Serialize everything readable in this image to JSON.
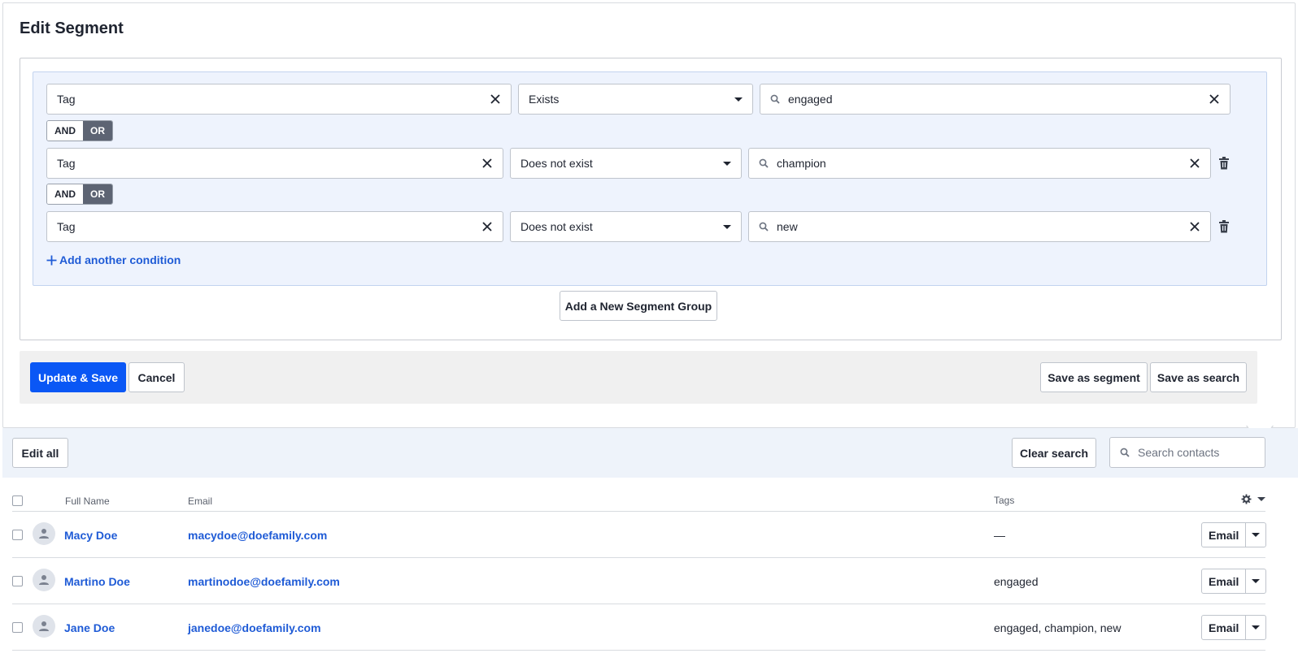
{
  "page": {
    "title": "Edit Segment"
  },
  "conditions": [
    {
      "field": "Tag",
      "operator": "Exists",
      "value": "engaged",
      "connector": null,
      "deletable": false
    },
    {
      "field": "Tag",
      "operator": "Does not exist",
      "value": "champion",
      "connector": {
        "and": "AND",
        "or": "OR",
        "selected": "OR"
      },
      "deletable": true
    },
    {
      "field": "Tag",
      "operator": "Does not exist",
      "value": "new",
      "connector": {
        "and": "AND",
        "or": "OR",
        "selected": "OR"
      },
      "deletable": true
    }
  ],
  "add_condition_label": "Add another condition",
  "add_group_label": "Add a New Segment Group",
  "actions": {
    "update_save": "Update & Save",
    "cancel": "Cancel",
    "save_segment": "Save as segment",
    "save_search": "Save as search"
  },
  "toolbar": {
    "edit_all": "Edit all",
    "clear_search": "Clear search",
    "search_placeholder": "Search contacts"
  },
  "table": {
    "columns": {
      "name": "Full Name",
      "email": "Email",
      "tags": "Tags"
    },
    "rows": [
      {
        "name": "Macy Doe",
        "email": "macydoe@doefamily.com",
        "tags": "—",
        "action": "Email"
      },
      {
        "name": "Martino Doe",
        "email": "martinodoe@doefamily.com",
        "tags": "engaged",
        "action": "Email"
      },
      {
        "name": "Jane Doe",
        "email": "janedoe@doefamily.com",
        "tags": "engaged, champion, new",
        "action": "Email"
      }
    ]
  },
  "colors": {
    "primary": "#0a57f5",
    "link": "#1f5bd6",
    "toggle_active": "#5d6473",
    "group_bg": "#eef3fd"
  }
}
